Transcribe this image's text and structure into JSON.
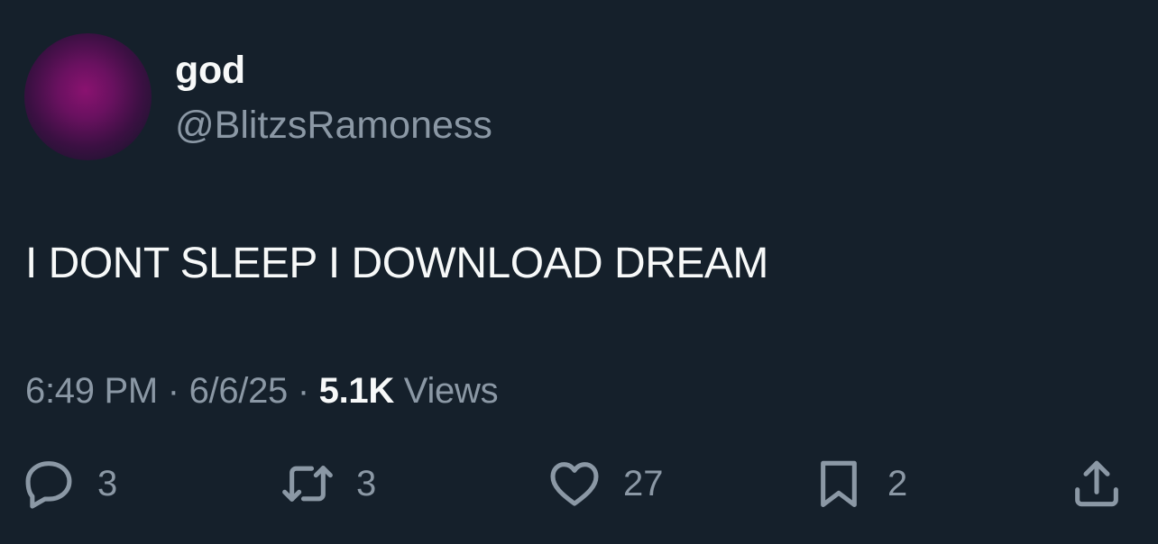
{
  "author": {
    "display_name": "god",
    "handle": "@BlitzsRamoness"
  },
  "tweet": {
    "text": "I DONT SLEEP I DOWNLOAD DREAM"
  },
  "meta": {
    "time": "6:49 PM",
    "separator": "·",
    "date": "6/6/25",
    "views_count": "5.1K",
    "views_label": "Views"
  },
  "actions": {
    "reply": {
      "icon": "reply-icon",
      "count": "3"
    },
    "retweet": {
      "icon": "retweet-icon",
      "count": "3"
    },
    "like": {
      "icon": "heart-icon",
      "count": "27"
    },
    "bookmark": {
      "icon": "bookmark-icon",
      "count": "2"
    },
    "share": {
      "icon": "share-icon"
    }
  },
  "colors": {
    "background": "#15202b",
    "primary_text": "#f7f9f9",
    "secondary_text": "#8b98a5",
    "avatar": "#7a1268"
  }
}
